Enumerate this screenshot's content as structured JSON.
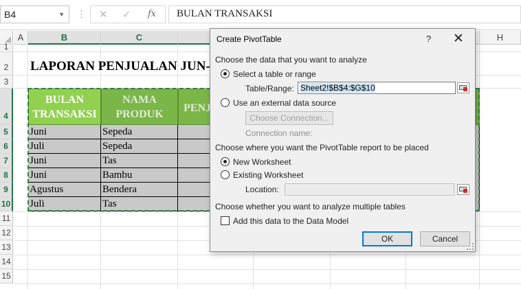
{
  "formula_bar": {
    "name_box": "B4",
    "separator": "⋮",
    "cancel_glyph": "✕",
    "enter_glyph": "✓",
    "fx_label": "fx",
    "formula": "BULAN TRANSAKSI"
  },
  "columns": [
    "A",
    "B",
    "C",
    "H"
  ],
  "rows": [
    "1",
    "2",
    "3",
    "4",
    "5",
    "6",
    "7",
    "8",
    "9",
    "10",
    "11",
    "12",
    "13",
    "14",
    "15"
  ],
  "sheet": {
    "title": "LAPORAN PENJUALAN JUN-A",
    "headers": [
      "BULAN TRANSAKSI",
      "NAMA PRODUK",
      "PENJ"
    ],
    "data_rows": [
      {
        "bulan": "Juni",
        "produk": "Sepeda"
      },
      {
        "bulan": "Juli",
        "produk": "Sepeda"
      },
      {
        "bulan": "Juni",
        "produk": "Tas"
      },
      {
        "bulan": "Juni",
        "produk": "Bambu"
      },
      {
        "bulan": "Agustus",
        "produk": "Bendera"
      },
      {
        "bulan": "Juli",
        "produk": "Tas"
      }
    ]
  },
  "dialog": {
    "title": "Create PivotTable",
    "help_glyph": "?",
    "close_glyph": "✕",
    "section_analyze": "Choose the data that you want to analyze",
    "opt_select_table": "Select a table or range",
    "table_range_label": "Table/Range:",
    "table_range_value": "Sheet2!$B$4:$G$10",
    "opt_external": "Use an external data source",
    "choose_connection": "Choose Connection...",
    "connection_name_label": "Connection name:",
    "section_place": "Choose where you want the PivotTable report to be placed",
    "opt_new_ws": "New Worksheet",
    "opt_existing_ws": "Existing Worksheet",
    "location_label": "Location:",
    "location_value": "",
    "section_multi": "Choose whether you want to analyze multiple tables",
    "data_model_label": "Add this data to the Data Model",
    "ok": "OK",
    "cancel": "Cancel"
  },
  "colors": {
    "header_fill": "#7ab648",
    "header_fill_selected": "#92d050",
    "data_fill": "#c9c9c9",
    "selection_accent": "#217346",
    "marquee": "#2f7d43",
    "ok_focus": "#0078d7"
  }
}
